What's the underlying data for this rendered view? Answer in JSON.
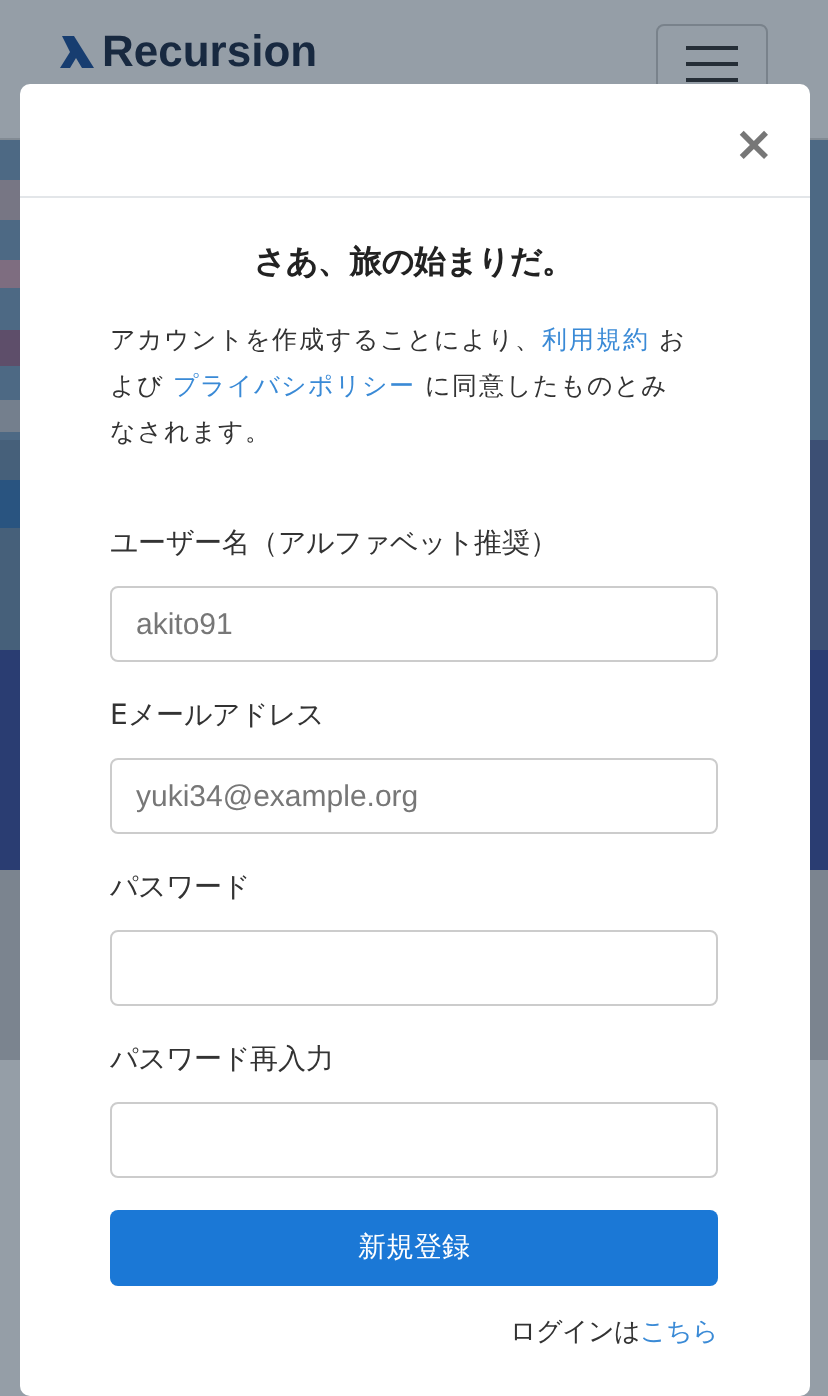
{
  "navbar": {
    "brand": "Recursion"
  },
  "modal": {
    "close": "×",
    "title": "さあ、旅の始まりだ。",
    "intro": [
      {
        "kind": "text",
        "text": "アカウントを作成することにより、"
      },
      {
        "kind": "link",
        "text": "利用規約"
      },
      {
        "kind": "text",
        "text": " および "
      },
      {
        "kind": "link",
        "text": "プライバシポリシー"
      },
      {
        "kind": "text",
        "text": " に同意したものとみなされます。"
      }
    ],
    "fields": [
      {
        "label": "ユーザー名（アルファベット推奨）",
        "placeholder": "akito91"
      },
      {
        "label": "Eメールアドレス",
        "placeholder": "yuki34@example.org"
      },
      {
        "label": "パスワード"
      },
      {
        "label": "パスワード再入力"
      }
    ],
    "submit": "新規登録",
    "login_text": "ログインは",
    "login_link": "こちら"
  }
}
